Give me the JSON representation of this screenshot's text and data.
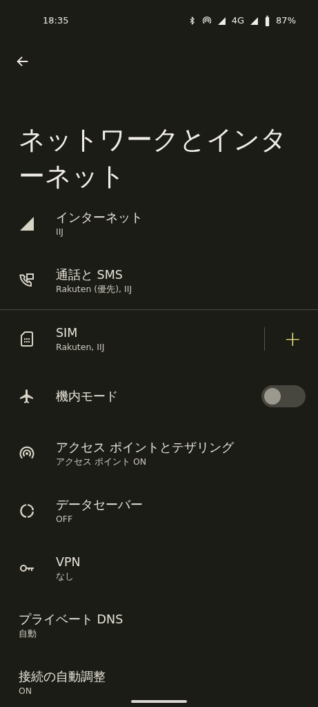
{
  "status_bar": {
    "time": "18:35",
    "network": "4G",
    "battery": "87%"
  },
  "title": "ネットワークとインターネット",
  "groups": [
    {
      "items": [
        {
          "kind": "signal",
          "title": "インターネット",
          "subtitle": "IIJ"
        },
        {
          "kind": "call-sms",
          "title": "通話と SMS",
          "subtitle": "Rakuten (優先), IIJ"
        }
      ]
    },
    {
      "items": [
        {
          "kind": "sim",
          "title": "SIM",
          "subtitle": "Rakuten, IIJ",
          "action": "+"
        },
        {
          "kind": "airplane",
          "title": "機内モード",
          "toggle": {
            "on": false
          }
        },
        {
          "kind": "hotspot",
          "title": "アクセス ポイントとテザリング",
          "subtitle": "アクセス ポイント ON"
        },
        {
          "kind": "data-saver",
          "title": "データセーバー",
          "subtitle": "OFF"
        },
        {
          "kind": "key",
          "title": "VPN",
          "subtitle": "なし"
        },
        {
          "title": "プライベート DNS",
          "subtitle": "自動"
        },
        {
          "title": "接続の自動調整",
          "subtitle": "ON"
        }
      ]
    }
  ]
}
